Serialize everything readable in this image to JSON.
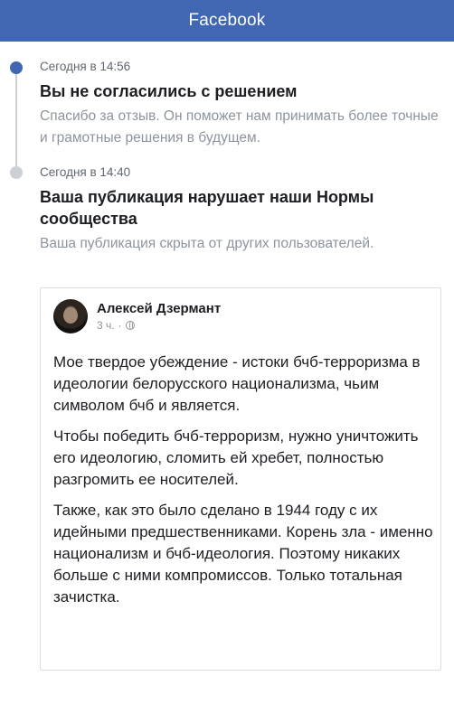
{
  "header": {
    "title": "Facebook"
  },
  "timeline": [
    {
      "time": "Сегодня в 14:56",
      "heading": "Вы не согласились с решением",
      "description": "Спасибо за отзыв. Он поможет нам принимать более точные и грамотные решения в будущем."
    },
    {
      "time": "Сегодня в 14:40",
      "heading": "Ваша публикация нарушает наши Нормы сообщества",
      "description": "Ваша публикация скрыта от других пользователей."
    }
  ],
  "post": {
    "author": "Алексей Дзермант",
    "time": "3 ч.",
    "separator": "·",
    "audience_icon": "globe-icon",
    "paragraphs": [
      "Мое твердое убеждение - истоки бчб-терроризма в идеологии белорусского национализма, чьим символом бчб и является.",
      "Чтобы победить бчб-терроризм, нужно уничтожить его идеологию, сломить ей хребет, полностью разгромить ее носителей.",
      "Также, как это было сделано в 1944 году с их идейными предшественниками. Корень зла - именно национализм и бчб-идеология. Поэтому никаких больше с ними компромиссов. Только тотальная зачистка."
    ]
  },
  "colors": {
    "brand": "#4267b2",
    "timeline_inactive": "#ccd0d5"
  }
}
